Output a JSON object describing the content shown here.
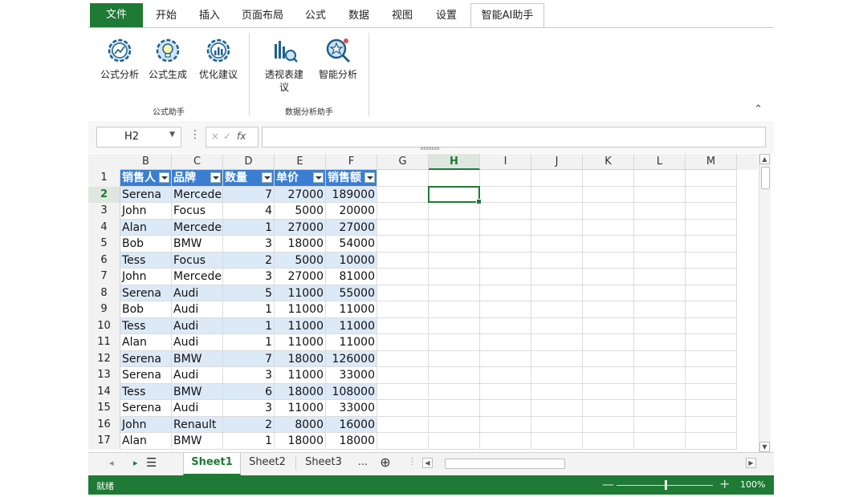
{
  "ribbon": {
    "tabs": [
      {
        "label": "文件",
        "kind": "file"
      },
      {
        "label": "开始"
      },
      {
        "label": "插入"
      },
      {
        "label": "页面布局"
      },
      {
        "label": "公式"
      },
      {
        "label": "数据"
      },
      {
        "label": "视图"
      },
      {
        "label": "设置"
      },
      {
        "label": "智能AI助手",
        "active": true
      }
    ],
    "groups": [
      {
        "label": "公式助手",
        "buttons": [
          {
            "label": "公式分析",
            "icon": "gear-chart-icon"
          },
          {
            "label": "公式生成",
            "icon": "gear-bulb-icon"
          },
          {
            "label": "优化建议",
            "icon": "gear-bars-icon"
          }
        ]
      },
      {
        "label": "数据分析助手",
        "buttons": [
          {
            "label": "透视表建议",
            "icon": "pivot-magnifier-icon"
          },
          {
            "label": "智能分析",
            "icon": "smart-analysis-icon"
          }
        ]
      }
    ],
    "collapse_icon": "chevron-up-icon"
  },
  "formula_bar": {
    "name_box": "H2",
    "cancel_icon": "×",
    "confirm_icon": "✓",
    "fx_label": "fx",
    "formula": ""
  },
  "grid": {
    "columns": [
      "B",
      "C",
      "D",
      "E",
      "F",
      "G",
      "H",
      "I",
      "J",
      "K",
      "L",
      "M"
    ],
    "selected_column": "H",
    "selected_row": "2",
    "selected_cell": "H2",
    "row_numbers": [
      "1",
      "2",
      "3",
      "4",
      "5",
      "6",
      "7",
      "8",
      "9",
      "10",
      "11",
      "12",
      "13",
      "14",
      "15",
      "16",
      "17"
    ],
    "table_headers": [
      "销售人",
      "品牌",
      "数量",
      "单价",
      "销售额"
    ],
    "table_rows": [
      [
        "Serena",
        "Mercedes",
        "7",
        "27000",
        "189000"
      ],
      [
        "John",
        "Focus",
        "4",
        "5000",
        "20000"
      ],
      [
        "Alan",
        "Mercedes",
        "1",
        "27000",
        "27000"
      ],
      [
        "Bob",
        "BMW",
        "3",
        "18000",
        "54000"
      ],
      [
        "Tess",
        "Focus",
        "2",
        "5000",
        "10000"
      ],
      [
        "John",
        "Mercedes",
        "3",
        "27000",
        "81000"
      ],
      [
        "Serena",
        "Audi",
        "5",
        "11000",
        "55000"
      ],
      [
        "Bob",
        "Audi",
        "1",
        "11000",
        "11000"
      ],
      [
        "Tess",
        "Audi",
        "1",
        "11000",
        "11000"
      ],
      [
        "Alan",
        "Audi",
        "1",
        "11000",
        "11000"
      ],
      [
        "Serena",
        "BMW",
        "7",
        "18000",
        "126000"
      ],
      [
        "Serena",
        "Audi",
        "3",
        "11000",
        "33000"
      ],
      [
        "Tess",
        "BMW",
        "6",
        "18000",
        "108000"
      ],
      [
        "Serena",
        "Audi",
        "3",
        "11000",
        "33000"
      ],
      [
        "John",
        "Renault",
        "2",
        "8000",
        "16000"
      ],
      [
        "Alan",
        "BMW",
        "1",
        "18000",
        "18000"
      ]
    ]
  },
  "sheets": {
    "tabs": [
      "Sheet1",
      "Sheet2",
      "Sheet3"
    ],
    "active": "Sheet1",
    "more": "...",
    "add_icon": "⊕"
  },
  "status": {
    "ready": "就绪",
    "zoom_minus": "—",
    "zoom_plus": "+",
    "zoom": "100%"
  },
  "colors": {
    "brand_green": "#1e7a34",
    "table_header_blue": "#3b7ed1",
    "band_blue": "#dce9f7"
  }
}
